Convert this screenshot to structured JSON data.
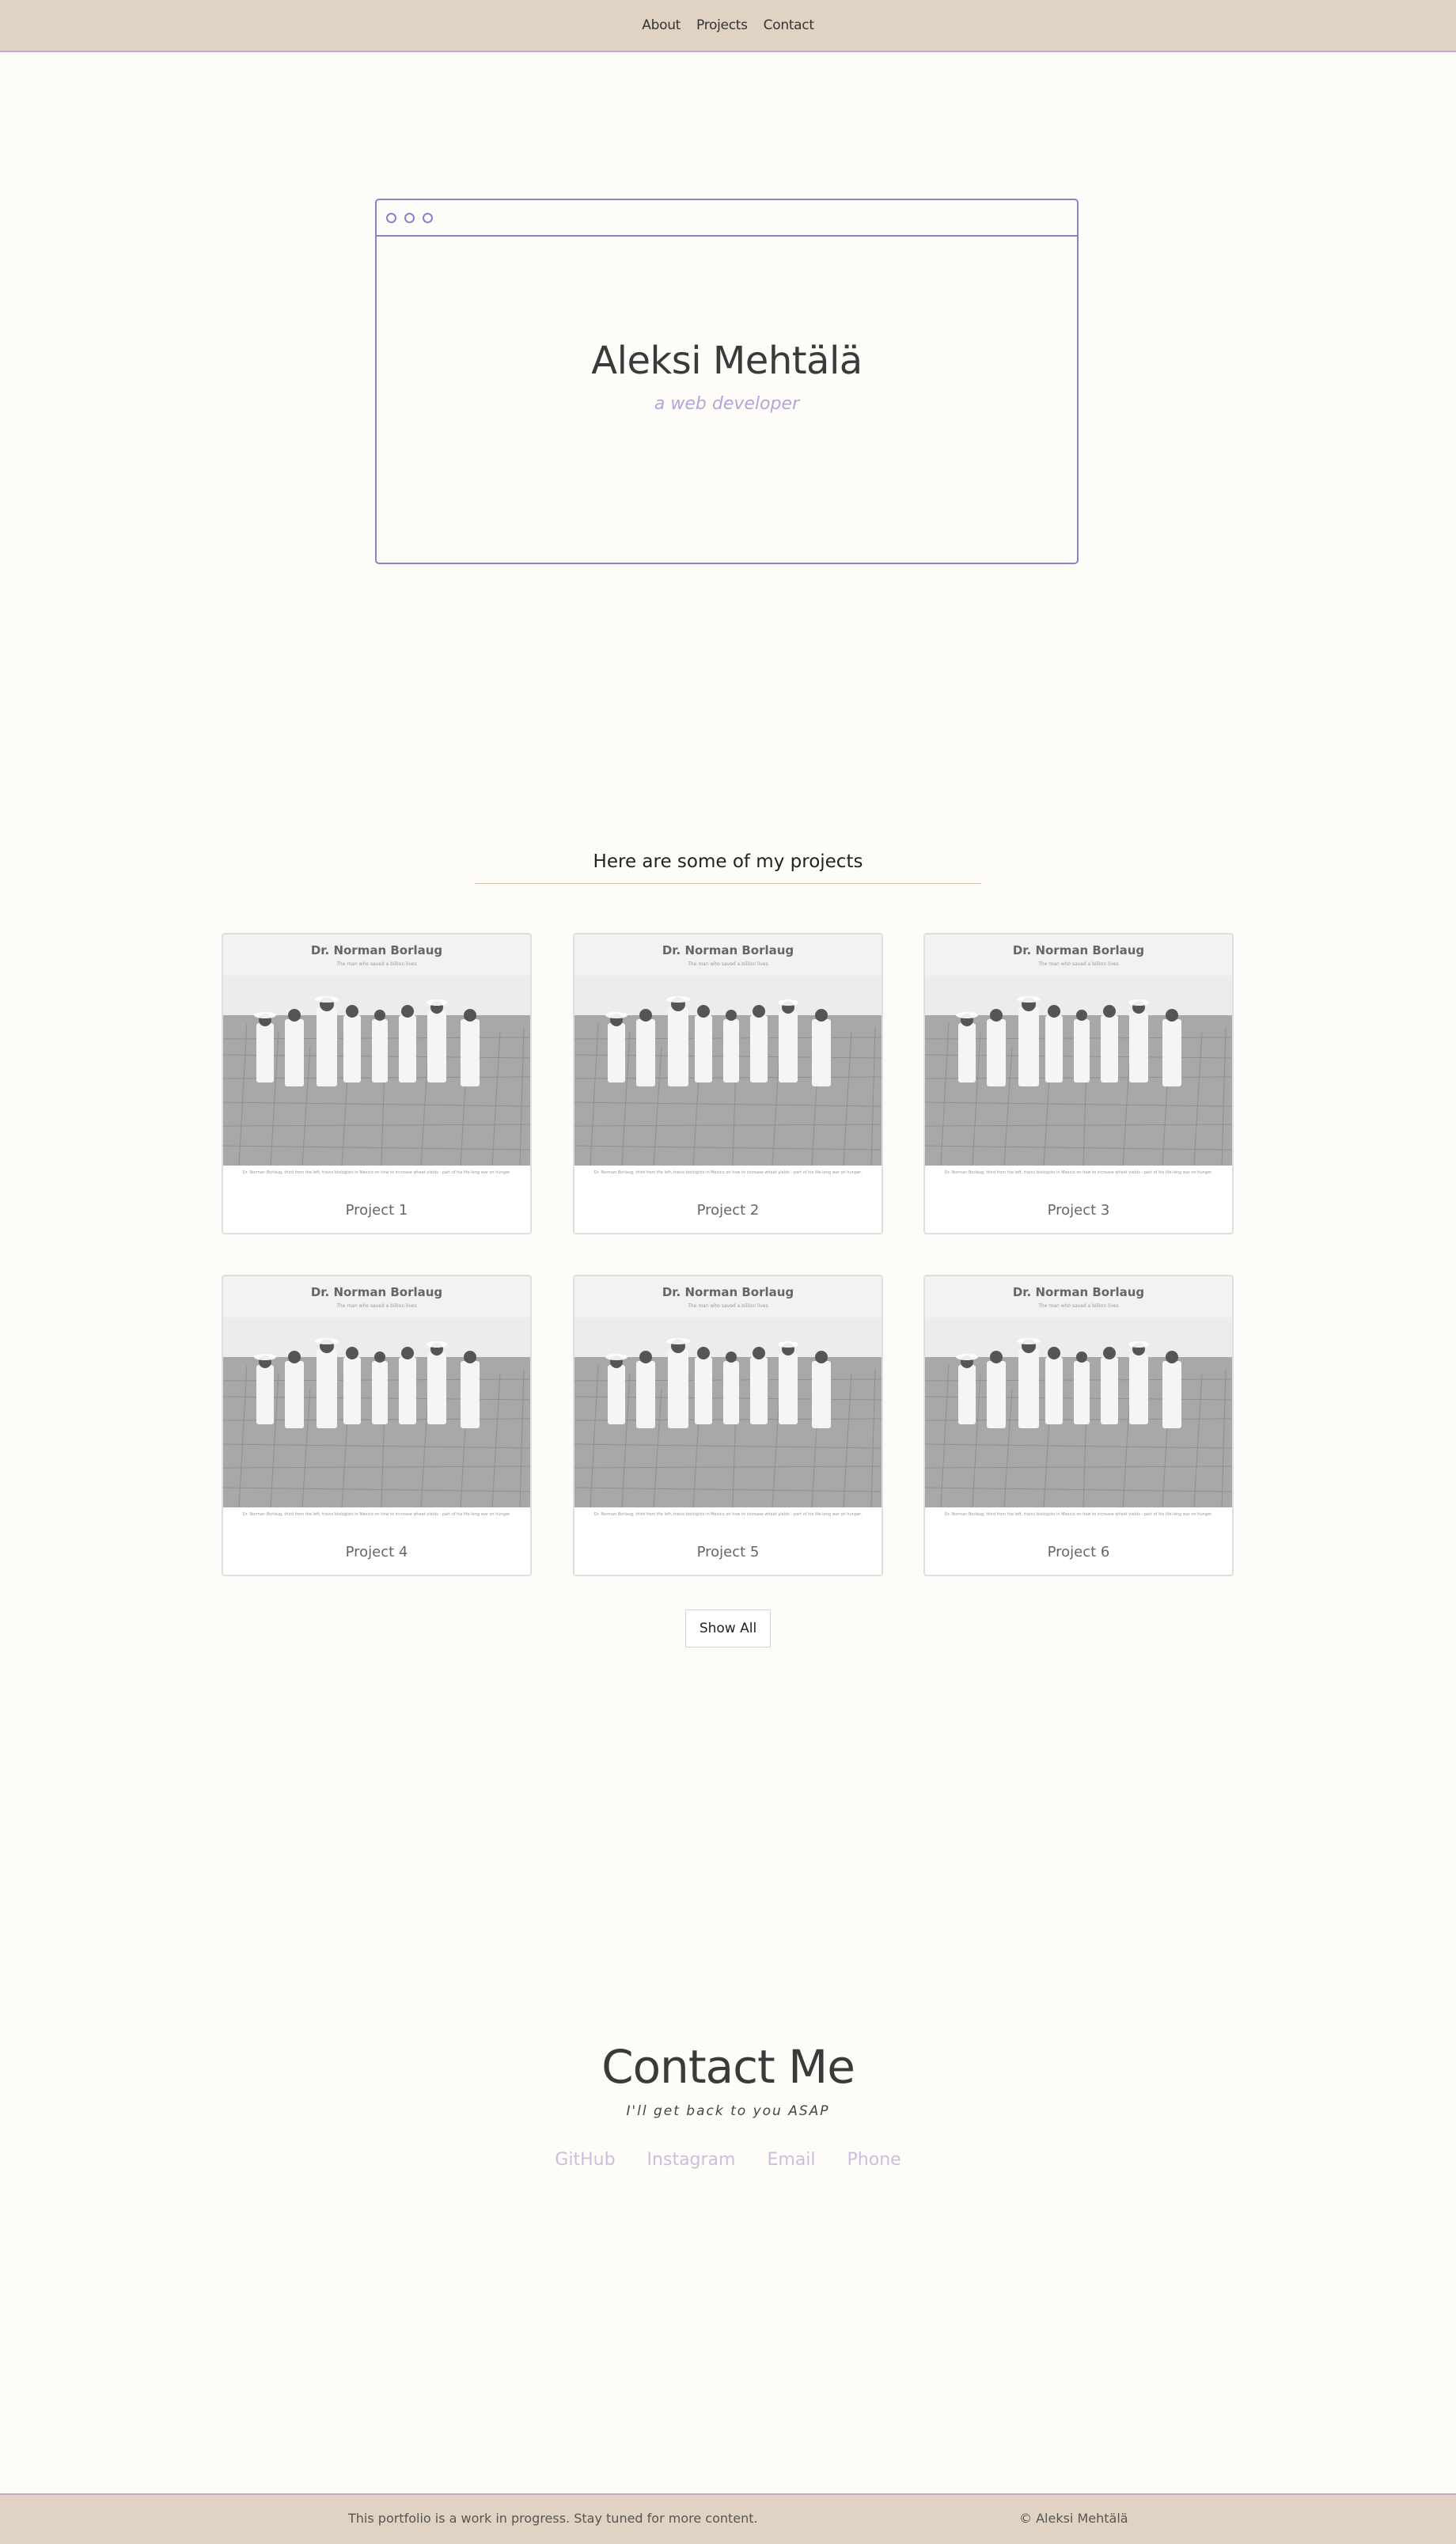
{
  "nav": {
    "items": [
      {
        "label": "About"
      },
      {
        "label": "Projects"
      },
      {
        "label": "Contact"
      }
    ]
  },
  "hero": {
    "name": "Aleksi Mehtälä",
    "subtitle": "a web developer"
  },
  "projects": {
    "heading": "Here are some of my projects",
    "cards": [
      {
        "preview_title": "Dr. Norman Borlaug",
        "preview_subtitle": "The man who saved a billion lives",
        "preview_caption": "Dr. Norman Borlaug, third from the left, trains biologists in Mexico on how to increase wheat yields - part of his life-long war on hunger.",
        "label": "Project 1"
      },
      {
        "preview_title": "Dr. Norman Borlaug",
        "preview_subtitle": "The man who saved a billion lives",
        "preview_caption": "Dr. Norman Borlaug, third from the left, trains biologists in Mexico on how to increase wheat yields - part of his life-long war on hunger.",
        "label": "Project 2"
      },
      {
        "preview_title": "Dr. Norman Borlaug",
        "preview_subtitle": "The man who saved a billion lives",
        "preview_caption": "Dr. Norman Borlaug, third from the left, trains biologists in Mexico on how to increase wheat yields - part of his life-long war on hunger.",
        "label": "Project 3"
      },
      {
        "preview_title": "Dr. Norman Borlaug",
        "preview_subtitle": "The man who saved a billion lives",
        "preview_caption": "Dr. Norman Borlaug, third from the left, trains biologists in Mexico on how to increase wheat yields - part of his life-long war on hunger.",
        "label": "Project 4"
      },
      {
        "preview_title": "Dr. Norman Borlaug",
        "preview_subtitle": "The man who saved a billion lives",
        "preview_caption": "Dr. Norman Borlaug, third from the left, trains biologists in Mexico on how to increase wheat yields - part of his life-long war on hunger.",
        "label": "Project 5"
      },
      {
        "preview_title": "Dr. Norman Borlaug",
        "preview_subtitle": "The man who saved a billion lives",
        "preview_caption": "Dr. Norman Borlaug, third from the left, trains biologists in Mexico on how to increase wheat yields - part of his life-long war on hunger.",
        "label": "Project 6"
      }
    ],
    "show_all_label": "Show All"
  },
  "contact": {
    "title": "Contact Me",
    "subtitle": "I'll get back to you ASAP",
    "links": [
      {
        "label": "GitHub"
      },
      {
        "label": "Instagram"
      },
      {
        "label": "Email"
      },
      {
        "label": "Phone"
      }
    ]
  },
  "footer": {
    "note": "This portfolio is a work in progress. Stay tuned for more content.",
    "copyright": "© Aleksi Mehtälä"
  },
  "colors": {
    "nav_bg": "#e0d3c4",
    "accent_purple": "#8d7fc9",
    "link_lavender": "#cbbfdd",
    "page_bg": "#fdfcf8"
  }
}
